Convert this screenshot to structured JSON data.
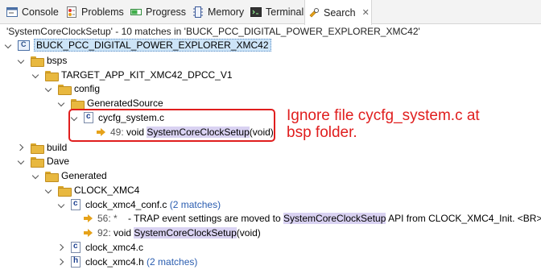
{
  "tabs": [
    {
      "label": "Console",
      "icon": "console-icon"
    },
    {
      "label": "Problems",
      "icon": "problems-icon"
    },
    {
      "label": "Progress",
      "icon": "progress-icon"
    },
    {
      "label": "Memory",
      "icon": "memory-icon"
    },
    {
      "label": "Terminal",
      "icon": "terminal-icon"
    },
    {
      "label": "Search",
      "icon": "search-icon",
      "active": true,
      "close": "✕"
    }
  ],
  "search_summary": "'SystemCoreClockSetup' - 10 matches in 'BUCK_PCC_DIGITAL_POWER_EXPLORER_XMC42'",
  "tree": {
    "project": "BUCK_PCC_DIGITAL_POWER_EXPLORER_XMC42",
    "bsps": "bsps",
    "target_app": "TARGET_APP_KIT_XMC42_DPCC_V1",
    "config": "config",
    "generated_source": "GeneratedSource",
    "cycfg_file": "cycfg_system.c",
    "cycfg_match": {
      "line": "49:",
      "pre": "void ",
      "match": "SystemCoreClockSetup",
      "post": "(void)"
    },
    "build": "build",
    "dave": "Dave",
    "generated": "Generated",
    "clock_xmc4_folder": "CLOCK_XMC4",
    "clock_conf_file": "clock_xmc4_conf.c",
    "clock_conf_count": "(2 matches)",
    "conf_match_1": {
      "line": "56: *",
      "pre": "    - TRAP event settings are moved to ",
      "match": "SystemCoreClockSetup",
      "post": " API from CLOCK_XMC4_Init. <BR>"
    },
    "conf_match_2": {
      "line": "92:",
      "pre": "void ",
      "match": "SystemCoreClockSetup",
      "post": "(void)"
    },
    "clock_c_file": "clock_xmc4.c",
    "clock_h_file": "clock_xmc4.h",
    "clock_h_count": "(2 matches)"
  },
  "annotation": {
    "line1": "Ignore file cycfg_system.c at",
    "line2": "bsp folder.",
    "color": "#e01e1e"
  },
  "colors": {
    "match_highlight": "#d9d2f2",
    "count_text": "#2a5db0",
    "selection": "#cde4f7"
  }
}
